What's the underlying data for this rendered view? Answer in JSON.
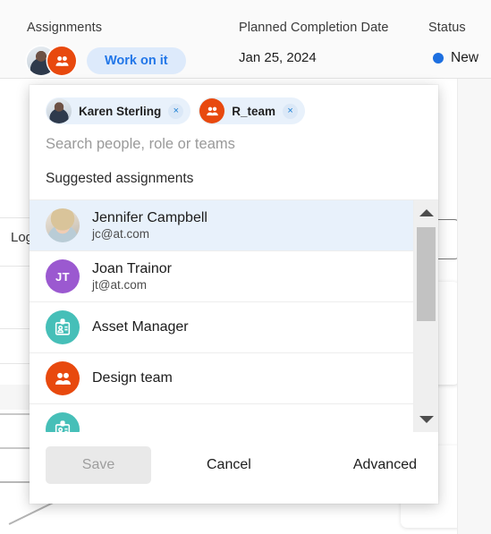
{
  "record_header": {
    "columns": [
      {
        "label": "Assignments"
      },
      {
        "label": "Planned Completion Date"
      },
      {
        "label": "Status"
      }
    ],
    "assignment_button": "Work on it",
    "planned_completion_date": "Jan 25, 2024",
    "status": {
      "text": "New",
      "dot_color": "#1d6fe0"
    }
  },
  "background": {
    "partial_label": "Log"
  },
  "assign_popup": {
    "selected": [
      {
        "name": "Karen Sterling",
        "avatar_type": "photo",
        "remove_label": "×"
      },
      {
        "name": "R_team",
        "avatar_type": "team",
        "remove_label": "×"
      }
    ],
    "search": {
      "value": "",
      "placeholder": "Search people, role or teams"
    },
    "suggestions_heading": "Suggested assignments",
    "suggestions": [
      {
        "name": "Jennifer Campbell",
        "email": "jc@at.com",
        "avatar_type": "photo2",
        "selected": true
      },
      {
        "name": "Joan Trainor",
        "email": "jt@at.com",
        "avatar_type": "initials",
        "initials": "JT",
        "avatar_color": "#9b59d0",
        "selected": false
      },
      {
        "name": "Asset Manager",
        "email": "",
        "avatar_type": "badge",
        "avatar_color": "#46bfb8",
        "selected": false
      },
      {
        "name": "Design team",
        "email": "",
        "avatar_type": "team",
        "avatar_color": "#e8490e",
        "selected": false
      },
      {
        "name": "",
        "email": "",
        "avatar_type": "badge",
        "avatar_color": "#46bfb8",
        "selected": false
      }
    ],
    "scrollbar": {
      "up_arrow": "▲",
      "down_arrow": "▼"
    },
    "footer": {
      "save": "Save",
      "cancel": "Cancel",
      "advanced": "Advanced"
    }
  },
  "colors": {
    "accent_blue": "#2176e8",
    "chip_bg": "#e8f1fb",
    "team_orange": "#e8490e",
    "badge_teal": "#46bfb8",
    "initials_purple": "#9b59d0"
  }
}
